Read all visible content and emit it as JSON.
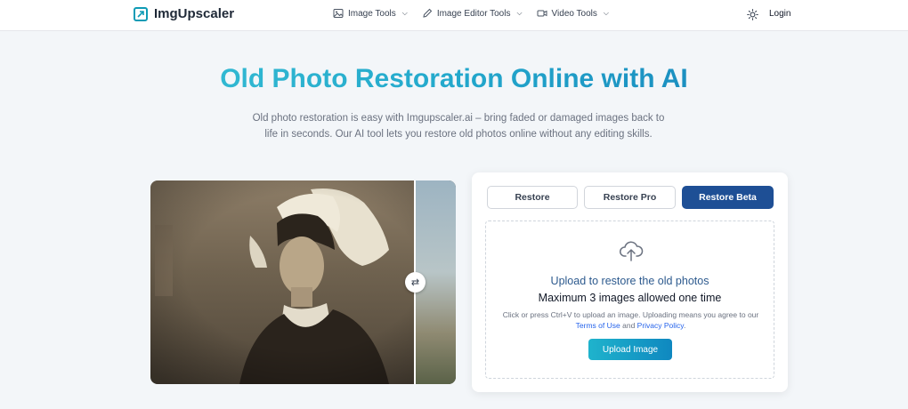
{
  "header": {
    "logo_text": "ImgUpscaler",
    "nav": [
      {
        "label": "Image Tools",
        "icon": "image-icon"
      },
      {
        "label": "Image Editor Tools",
        "icon": "pencil-icon"
      },
      {
        "label": "Video Tools",
        "icon": "video-icon"
      }
    ],
    "theme_icon": "sun-icon",
    "login_label": "Login"
  },
  "hero": {
    "title": "Old Photo Restoration Online with AI",
    "subtitle": "Old photo restoration is easy with Imgupscaler.ai – bring faded or damaged images back to life in seconds. Our AI tool lets you restore old photos online without any editing skills."
  },
  "comparison": {
    "swap_icon": "swap-arrows-icon",
    "swap_glyph": "⇄"
  },
  "upload": {
    "tabs": [
      {
        "label": "Restore"
      },
      {
        "label": "Restore Pro"
      },
      {
        "label": "Restore Beta",
        "active": true
      }
    ],
    "title": "Upload to restore the old photos",
    "max_text": "Maximum 3 images allowed one time",
    "note_prefix": "Click or press Ctrl+V to upload an image. Uploading means you agree to our ",
    "terms_link": "Terms of Use",
    "note_and": " and ",
    "privacy_link": "Privacy Policy",
    "note_suffix": ".",
    "button_label": "Upload Image",
    "upload_icon": "cloud-upload-icon"
  },
  "colors": {
    "accent_teal": "#1fb3cc",
    "active_tab": "#1e4f95",
    "link_blue": "#2563eb"
  }
}
